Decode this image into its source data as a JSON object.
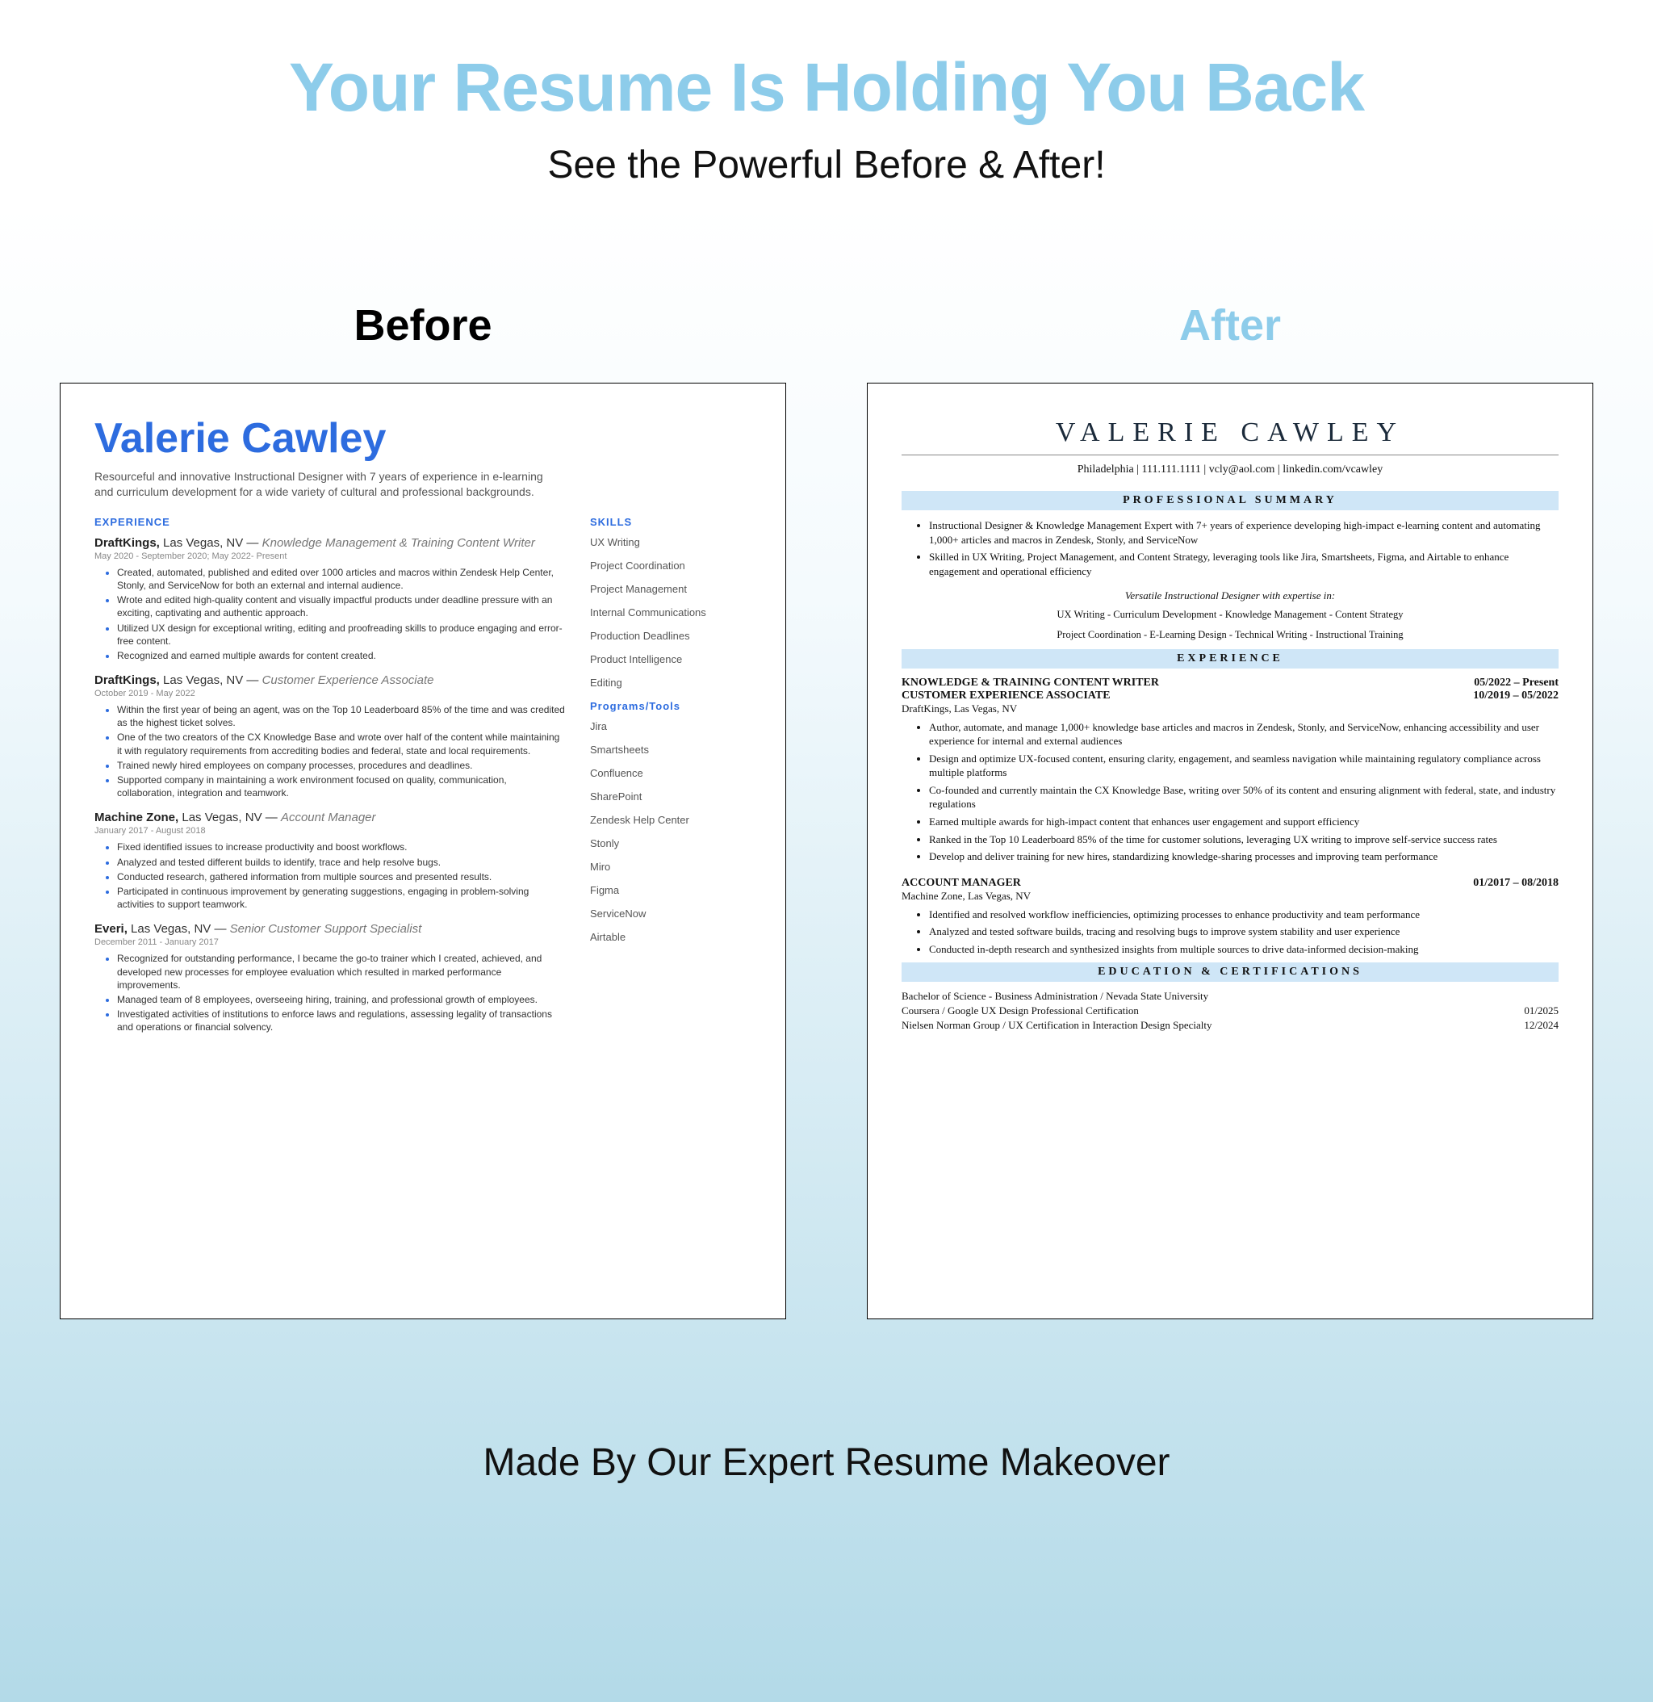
{
  "headline": "Your Resume Is Holding You Back",
  "subhead": "See the Powerful Before & After!",
  "labels": {
    "before": "Before",
    "after": "After"
  },
  "footer": "Made By Our Expert Resume Makeover",
  "before": {
    "name": "Valerie Cawley",
    "summary": "Resourceful and innovative Instructional Designer with 7 years of experience in e-learning and curriculum development for a wide variety of cultural and professional backgrounds.",
    "sections": {
      "experience": "EXPERIENCE",
      "skills": "SKILLS",
      "programs": "Programs/Tools"
    },
    "jobs": [
      {
        "company": "DraftKings,",
        "location": "Las Vegas, NV —",
        "role": "Knowledge Management & Training Content Writer",
        "dates": "May 2020 - September 2020; May 2022- Present",
        "bullets": [
          "Created, automated, published and edited over 1000 articles and macros within Zendesk Help Center, Stonly, and ServiceNow for both an external and internal audience.",
          "Wrote and edited high-quality content and visually impactful products under deadline pressure with an exciting, captivating and authentic approach.",
          "Utilized UX design for exceptional writing, editing and proofreading skills to produce engaging and error-free content.",
          "Recognized and earned multiple awards for content created."
        ]
      },
      {
        "company": "DraftKings,",
        "location": "Las Vegas, NV —",
        "role": "Customer Experience Associate",
        "dates": "October 2019 - May 2022",
        "bullets": [
          "Within the first year of being an agent, was on the Top 10 Leaderboard 85% of the time and was credited as the highest ticket solves.",
          "One of the two creators of the CX Knowledge Base and wrote over half of the content while maintaining it with regulatory requirements from accrediting bodies and federal, state and local requirements.",
          "Trained newly hired employees on company processes, procedures and deadlines.",
          "Supported company in maintaining a work environment focused on quality, communication, collaboration, integration and teamwork."
        ]
      },
      {
        "company": "Machine Zone,",
        "location": "Las Vegas, NV —",
        "role": "Account Manager",
        "dates": "January 2017 - August 2018",
        "bullets": [
          "Fixed identified issues to increase productivity and boost workflows.",
          "Analyzed and tested different builds to identify, trace and help resolve bugs.",
          "Conducted research, gathered information from multiple sources and presented results.",
          "Participated in continuous improvement by generating suggestions, engaging in problem-solving activities to support teamwork."
        ]
      },
      {
        "company": "Everi,",
        "location": "Las Vegas, NV —",
        "role": "Senior Customer Support Specialist",
        "dates": "December 2011 - January 2017",
        "bullets": [
          "Recognized for outstanding performance, I became the go-to trainer which I created, achieved, and developed new processes for employee evaluation which resulted in marked performance improvements.",
          "Managed team of 8 employees, overseeing hiring, training, and professional growth of employees.",
          "Investigated activities of institutions to enforce laws and regulations, assessing legality of transactions and operations or financial solvency."
        ]
      }
    ],
    "skills": [
      "UX Writing",
      "Project Coordination",
      "Project Management",
      "Internal Communications",
      "Production Deadlines",
      "Product Intelligence",
      "Editing"
    ],
    "programs": [
      "Jira",
      "Smartsheets",
      "Confluence",
      "SharePoint",
      "Zendesk Help Center",
      "Stonly",
      "Miro",
      "Figma",
      "ServiceNow",
      "Airtable"
    ]
  },
  "after": {
    "name": "VALERIE CAWLEY",
    "contact": "Philadelphia | 111.111.1111 | vcly@aol.com | linkedin.com/vcawley",
    "bars": {
      "summary": "PROFESSIONAL SUMMARY",
      "experience": "EXPERIENCE",
      "edu": "EDUCATION & CERTIFICATIONS"
    },
    "summary_bullets": [
      "Instructional Designer & Knowledge Management Expert with 7+ years of experience developing high-impact e-learning content and automating 1,000+ articles and macros in Zendesk, Stonly, and ServiceNow",
      "Skilled in UX Writing, Project Management, and Content Strategy, leveraging tools like Jira, Smartsheets, Figma, and Airtable to enhance engagement and operational efficiency"
    ],
    "tagline": "Versatile Instructional Designer with expertise in:",
    "kw1": "UX Writing - Curriculum Development - Knowledge Management - Content Strategy",
    "kw2": "Project Coordination - E-Learning Design - Technical Writing - Instructional Training",
    "exp": [
      {
        "title": "KNOWLEDGE & TRAINING CONTENT WRITER",
        "dates": "05/2022 – Present",
        "title2": "CUSTOMER EXPERIENCE ASSOCIATE",
        "dates2": "10/2019 – 05/2022",
        "sub": "DraftKings, Las Vegas, NV",
        "bullets": [
          "Author, automate, and manage 1,000+ knowledge base articles and macros in Zendesk, Stonly, and ServiceNow, enhancing accessibility and user experience for internal and external audiences",
          "Design and optimize UX-focused content, ensuring clarity, engagement, and seamless navigation while maintaining regulatory compliance across multiple platforms",
          "Co-founded and currently maintain the CX Knowledge Base, writing over 50% of its content and ensuring alignment with federal, state, and industry regulations",
          "Earned multiple awards for high-impact content that enhances user engagement and support efficiency",
          "Ranked in the Top 10 Leaderboard 85% of the time for customer solutions, leveraging UX writing to improve self-service success rates",
          "Develop and deliver training for new hires, standardizing knowledge-sharing processes and improving team performance"
        ]
      },
      {
        "title": "ACCOUNT MANAGER",
        "dates": "01/2017 – 08/2018",
        "sub": "Machine Zone, Las Vegas, NV",
        "bullets": [
          "Identified and resolved workflow inefficiencies, optimizing processes to enhance productivity and team performance",
          "Analyzed and tested software builds, tracing and resolving bugs to improve system stability and user experience",
          "Conducted in-depth research and synthesized insights from multiple sources to drive data-informed decision-making"
        ]
      }
    ],
    "edu": [
      {
        "line": "Bachelor of Science - Business Administration / Nevada State University",
        "date": ""
      },
      {
        "line": "Coursera / Google UX Design Professional Certification",
        "date": "01/2025"
      },
      {
        "line": "Nielsen Norman Group / UX Certification in Interaction Design Specialty",
        "date": "12/2024"
      }
    ]
  }
}
